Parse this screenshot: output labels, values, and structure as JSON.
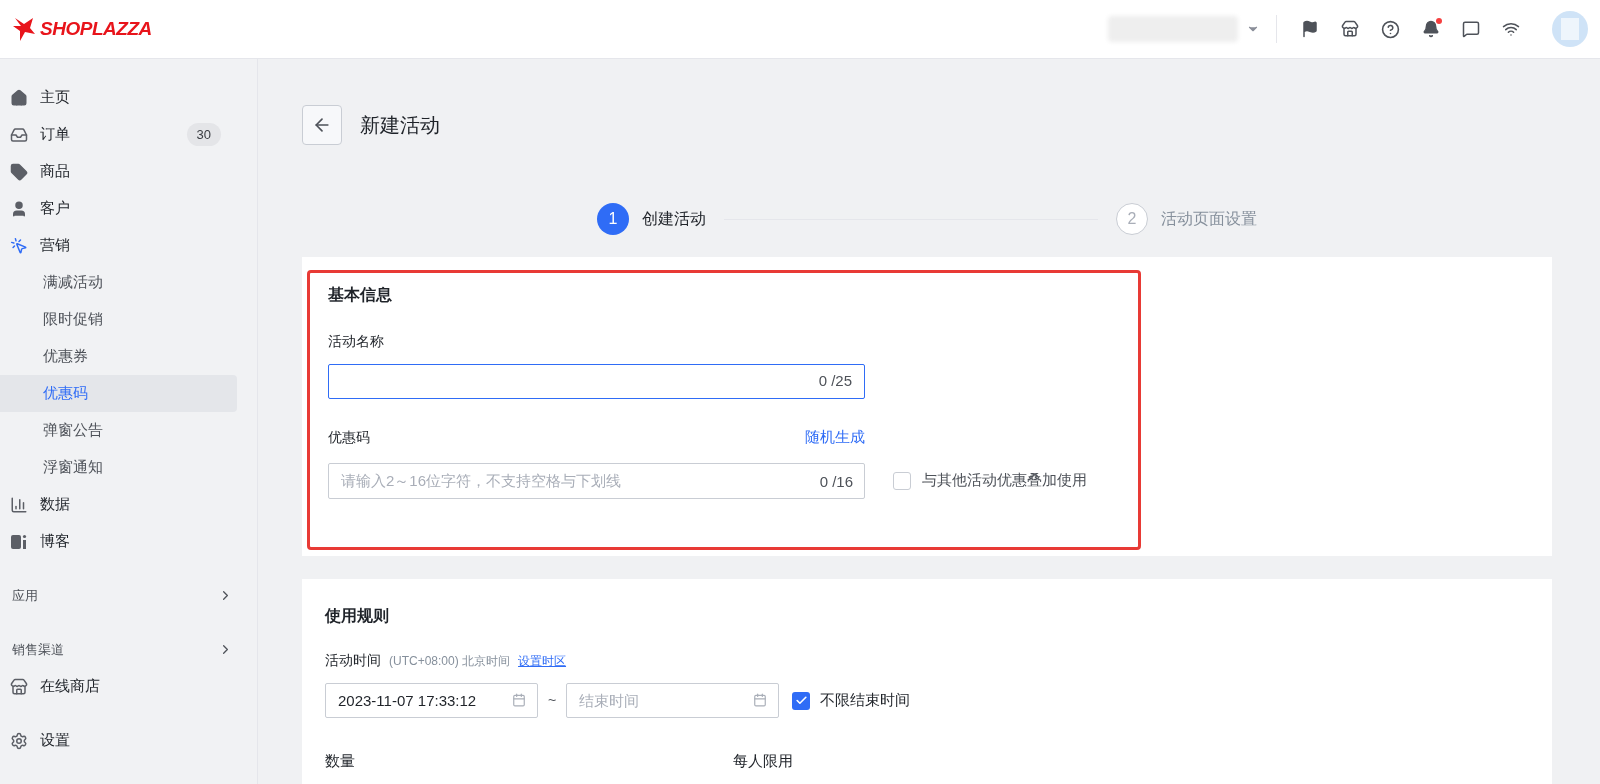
{
  "logo": {
    "text": "SHOPLAZZA"
  },
  "top_bar": {
    "notifications_unread": true
  },
  "sidebar": {
    "items": [
      {
        "kind": "main",
        "label": "主页",
        "selected": false
      },
      {
        "kind": "main",
        "label": "订单",
        "badge": "30",
        "selected": false
      },
      {
        "kind": "main",
        "label": "商品",
        "selected": false
      },
      {
        "kind": "main",
        "label": "客户",
        "selected": false
      },
      {
        "kind": "main",
        "label": "营销",
        "selected": false,
        "active": true
      },
      {
        "kind": "sub",
        "label": "满减活动",
        "selected": false
      },
      {
        "kind": "sub",
        "label": "限时促销",
        "selected": false
      },
      {
        "kind": "sub",
        "label": "优惠券",
        "selected": false
      },
      {
        "kind": "sub",
        "label": "优惠码",
        "selected": true
      },
      {
        "kind": "sub",
        "label": "弹窗公告",
        "selected": false
      },
      {
        "kind": "sub",
        "label": "浮窗通知",
        "selected": false
      },
      {
        "kind": "main",
        "label": "数据",
        "selected": false
      },
      {
        "kind": "main",
        "label": "博客",
        "selected": false
      },
      {
        "kind": "section",
        "label": "应用"
      },
      {
        "kind": "section",
        "label": "销售渠道"
      },
      {
        "kind": "main",
        "label": "在线商店",
        "selected": false
      },
      {
        "kind": "gap"
      },
      {
        "kind": "main",
        "label": "设置",
        "selected": false
      }
    ]
  },
  "page": {
    "title": "新建活动"
  },
  "steps": [
    {
      "number": "1",
      "label": "创建活动",
      "selected": true
    },
    {
      "number": "2",
      "label": "活动页面设置",
      "selected": false
    }
  ],
  "basic_info": {
    "title": "基本信息",
    "highlighted": true,
    "name_field": {
      "label": "活动名称",
      "counter": "0 /25",
      "focused": true
    },
    "code_field": {
      "label": "优惠码",
      "action": "随机生成",
      "placeholder": "请输入2～16位字符，不支持空格与下划线",
      "counter": "0 /16"
    },
    "stacking": {
      "label": "与其他活动优惠叠加使用",
      "checked": false
    }
  },
  "usage_rules": {
    "title": "使用规则",
    "time_label": "活动时间",
    "timezone": "(UTC+08:00) 北京时间",
    "timezone_link": "设置时区",
    "start_value": "2023-11-07 17:33:12",
    "separator": "~",
    "end_placeholder": "结束时间",
    "no_end": {
      "label": "不限结束时间",
      "checked": true
    },
    "quantity_label": "数量",
    "per_person_label": "每人限用"
  }
}
